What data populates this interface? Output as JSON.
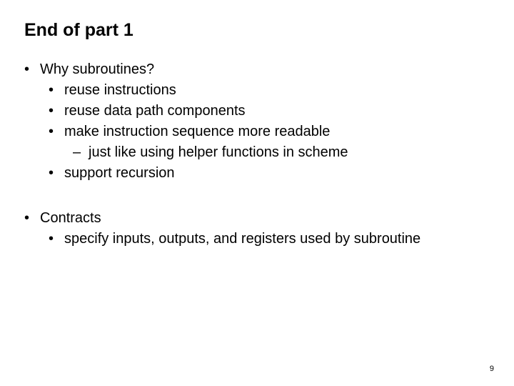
{
  "title": "End of part 1",
  "b1": {
    "text": "Why subroutines?"
  },
  "b1a": {
    "text": "reuse instructions"
  },
  "b1b": {
    "text": "reuse data path components"
  },
  "b1c": {
    "text": "make instruction sequence more readable"
  },
  "b1c1": {
    "text": "just like using helper functions in scheme"
  },
  "b1d": {
    "text": "support recursion"
  },
  "b2": {
    "text": "Contracts"
  },
  "b2a": {
    "text": "specify inputs, outputs, and registers used by subroutine"
  },
  "page_number": "9",
  "bullet": "•",
  "dash": "–"
}
